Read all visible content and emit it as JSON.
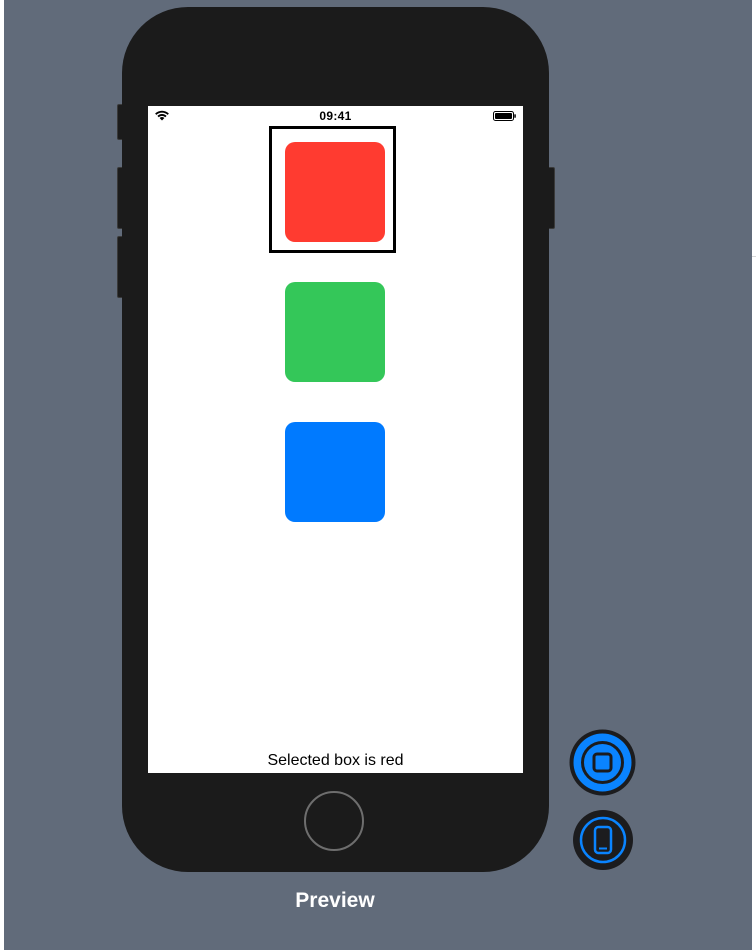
{
  "status_bar": {
    "time": "09:41"
  },
  "boxes": [
    {
      "color_name": "red",
      "color": "#ff3b30",
      "selected": true
    },
    {
      "color_name": "green",
      "color": "#34c759",
      "selected": false
    },
    {
      "color_name": "blue",
      "color": "#007aff",
      "selected": false
    }
  ],
  "selection_text": "Selected box is red",
  "canvas": {
    "title": "Preview",
    "background": "#616b7a",
    "accent": "#0a84ff"
  },
  "icons": {
    "live_preview": "live-preview-icon",
    "device": "device-icon",
    "wifi": "wifi-icon",
    "battery": "battery-icon"
  }
}
